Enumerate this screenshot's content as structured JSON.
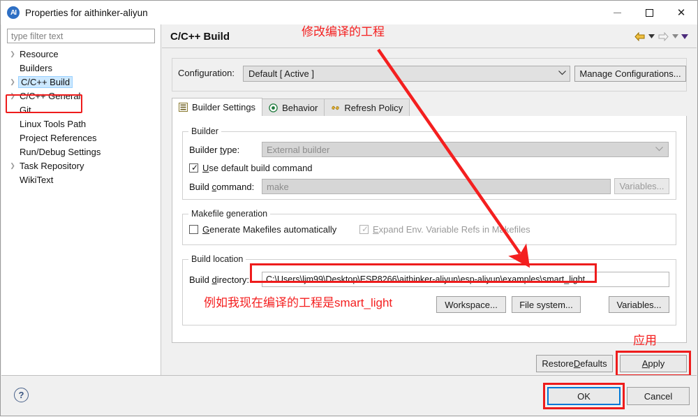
{
  "window": {
    "title": "Properties for aithinker-aliyun",
    "app_icon": "eclipse-icon",
    "minimize_label": "Minimize",
    "maximize_label": "Maximize",
    "close_label": "Close"
  },
  "sidebar": {
    "filter_placeholder": "type filter text",
    "filter_value": "",
    "items": [
      {
        "label": "Resource",
        "expandable": true,
        "selected": false
      },
      {
        "label": "Builders",
        "expandable": false,
        "selected": false
      },
      {
        "label": "C/C++ Build",
        "expandable": true,
        "selected": true
      },
      {
        "label": "C/C++ General",
        "expandable": true,
        "selected": false
      },
      {
        "label": "Git",
        "expandable": false,
        "selected": false
      },
      {
        "label": "Linux Tools Path",
        "expandable": false,
        "selected": false
      },
      {
        "label": "Project References",
        "expandable": false,
        "selected": false
      },
      {
        "label": "Run/Debug Settings",
        "expandable": false,
        "selected": false
      },
      {
        "label": "Task Repository",
        "expandable": true,
        "selected": false
      },
      {
        "label": "WikiText",
        "expandable": false,
        "selected": false
      }
    ]
  },
  "page": {
    "title": "C/C++ Build",
    "nav": {
      "back_icon": "back-arrow-icon",
      "back_menu_icon": "chevron-down-icon",
      "forward_icon": "forward-arrow-icon",
      "forward_menu_icon": "chevron-down-icon",
      "view_menu_icon": "chevron-down-filled-icon"
    }
  },
  "configuration": {
    "label": "Configuration:",
    "value": "Default  [ Active ]",
    "dropdown_icon": "chevron-down-icon",
    "manage_button": "Manage Configurations..."
  },
  "tabs": [
    {
      "label": "Builder Settings",
      "icon": "list-settings-icon",
      "active": true
    },
    {
      "label": "Behavior",
      "icon": "target-icon",
      "active": false
    },
    {
      "label": "Refresh Policy",
      "icon": "refresh-links-icon",
      "active": false
    }
  ],
  "builder_group": {
    "title": "Builder",
    "builder_type_label": "Builder type:",
    "builder_type_label_pre": "Builder ",
    "builder_type_label_mnemonic": "t",
    "builder_type_label_post": "ype:",
    "builder_type_value": "External builder",
    "builder_type_arrow": "chevron-down-icon",
    "use_default_pre": "",
    "use_default_mnemonic": "U",
    "use_default_post": "se default build command",
    "use_default_checked": true,
    "build_command_pre": "Build ",
    "build_command_mnemonic": "c",
    "build_command_post": "ommand:",
    "build_command_value": "make",
    "variables_button": "Variables..."
  },
  "makefile_group": {
    "title": "Makefile generation",
    "generate_pre": "",
    "generate_mnemonic": "G",
    "generate_post": "enerate Makefiles automatically",
    "generate_checked": false,
    "expand_pre": "",
    "expand_mnemonic": "E",
    "expand_post": "xpand Env. Variable Refs in Makefiles",
    "expand_checked": true,
    "expand_disabled": true
  },
  "build_location_group": {
    "title": "Build location",
    "directory_label_pre": "Build ",
    "directory_label_mnemonic": "d",
    "directory_label_post": "irectory:",
    "directory_value": "C:\\Users\\ljm99\\Desktop\\ESP8266\\aithinker-aliyun\\esp-aliyun\\examples\\smart_light",
    "workspace_button": "Workspace...",
    "filesystem_button": "File system...",
    "variables_button": "Variables..."
  },
  "page_buttons": {
    "restore_pre": "Restore ",
    "restore_mnemonic": "D",
    "restore_post": "efaults",
    "apply_pre": "",
    "apply_mnemonic": "A",
    "apply_post": "pply"
  },
  "footer": {
    "help_icon": "help-question-icon",
    "ok_button": "OK",
    "cancel_button": "Cancel"
  },
  "annotations": {
    "top": "修改编译的工程",
    "middle": "例如我现在编译的工程是smart_light",
    "apply": "应用",
    "color": "#f41f1f",
    "highlight_color": "#ee1c1c"
  }
}
